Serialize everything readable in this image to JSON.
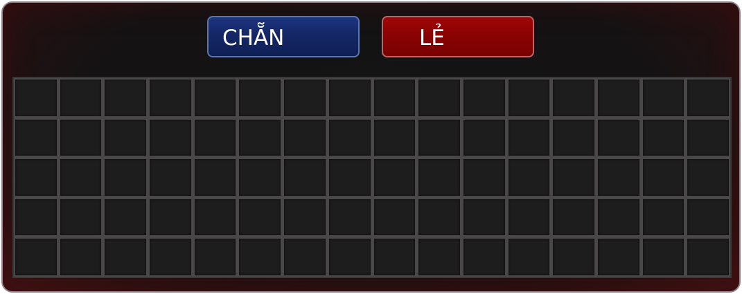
{
  "buttons": {
    "even_label": "CHẴN",
    "odd_label": "LẺ"
  },
  "board": {
    "columns": 16,
    "rows": 5,
    "cells": []
  },
  "colors": {
    "even": "#142766",
    "odd": "#8a0303",
    "panel_border": "#8e8a8c",
    "cell": "#1e1d1e",
    "grid_line": "#4a4748"
  }
}
